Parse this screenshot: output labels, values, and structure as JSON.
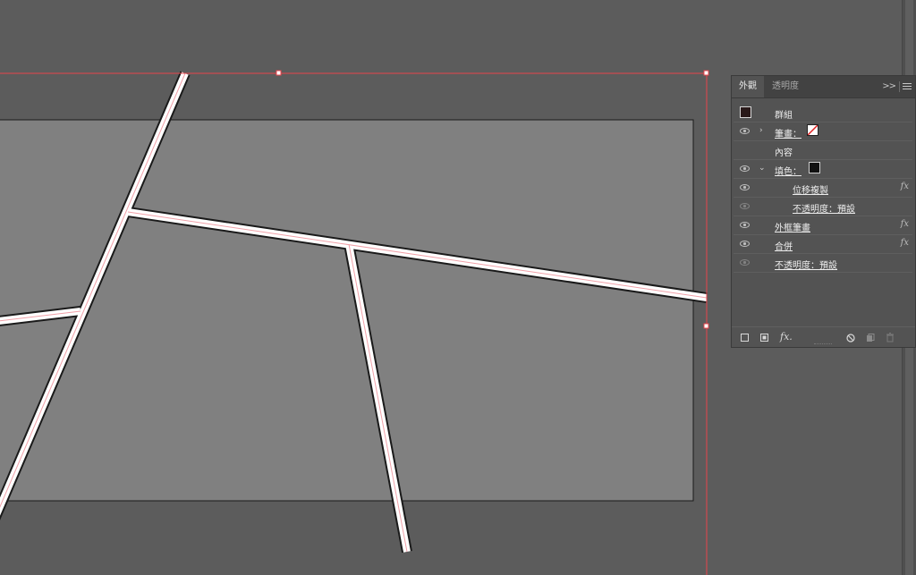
{
  "panel": {
    "tabs": [
      {
        "label": "外觀",
        "active": true
      },
      {
        "label": "透明度",
        "active": false
      }
    ],
    "collapse_glyph": ">>",
    "rows": {
      "group": {
        "label": "群組"
      },
      "stroke": {
        "label": "筆畫："
      },
      "contents": {
        "label": "內容"
      },
      "fill": {
        "label": "填色："
      },
      "offset_path": {
        "label": "位移複製",
        "fx": "fx"
      },
      "opacity_inner": {
        "label": "不透明度：預設"
      },
      "outline_stroke": {
        "label": "外框筆畫",
        "fx": "fx"
      },
      "merge": {
        "label": "合併",
        "fx": "fx"
      },
      "opacity_outer": {
        "label": "不透明度：預設"
      }
    },
    "bottom": {
      "add_stroke_icon": "square-outline-icon",
      "add_fill_icon": "square-filled-icon",
      "fx_label": "fx.",
      "clear_icon": "no-entry-icon",
      "duplicate_icon": "duplicate-icon",
      "delete_icon": "trash-icon"
    }
  },
  "colors": {
    "canvas_bg": "#5c5c5c",
    "artboard": "#808080",
    "selection": "#e8454c",
    "path_outline": "#1a1a1a",
    "path_fill": "#ffffff",
    "path_center": "#f0a0a8",
    "group_swatch": "#2a1a1a"
  }
}
